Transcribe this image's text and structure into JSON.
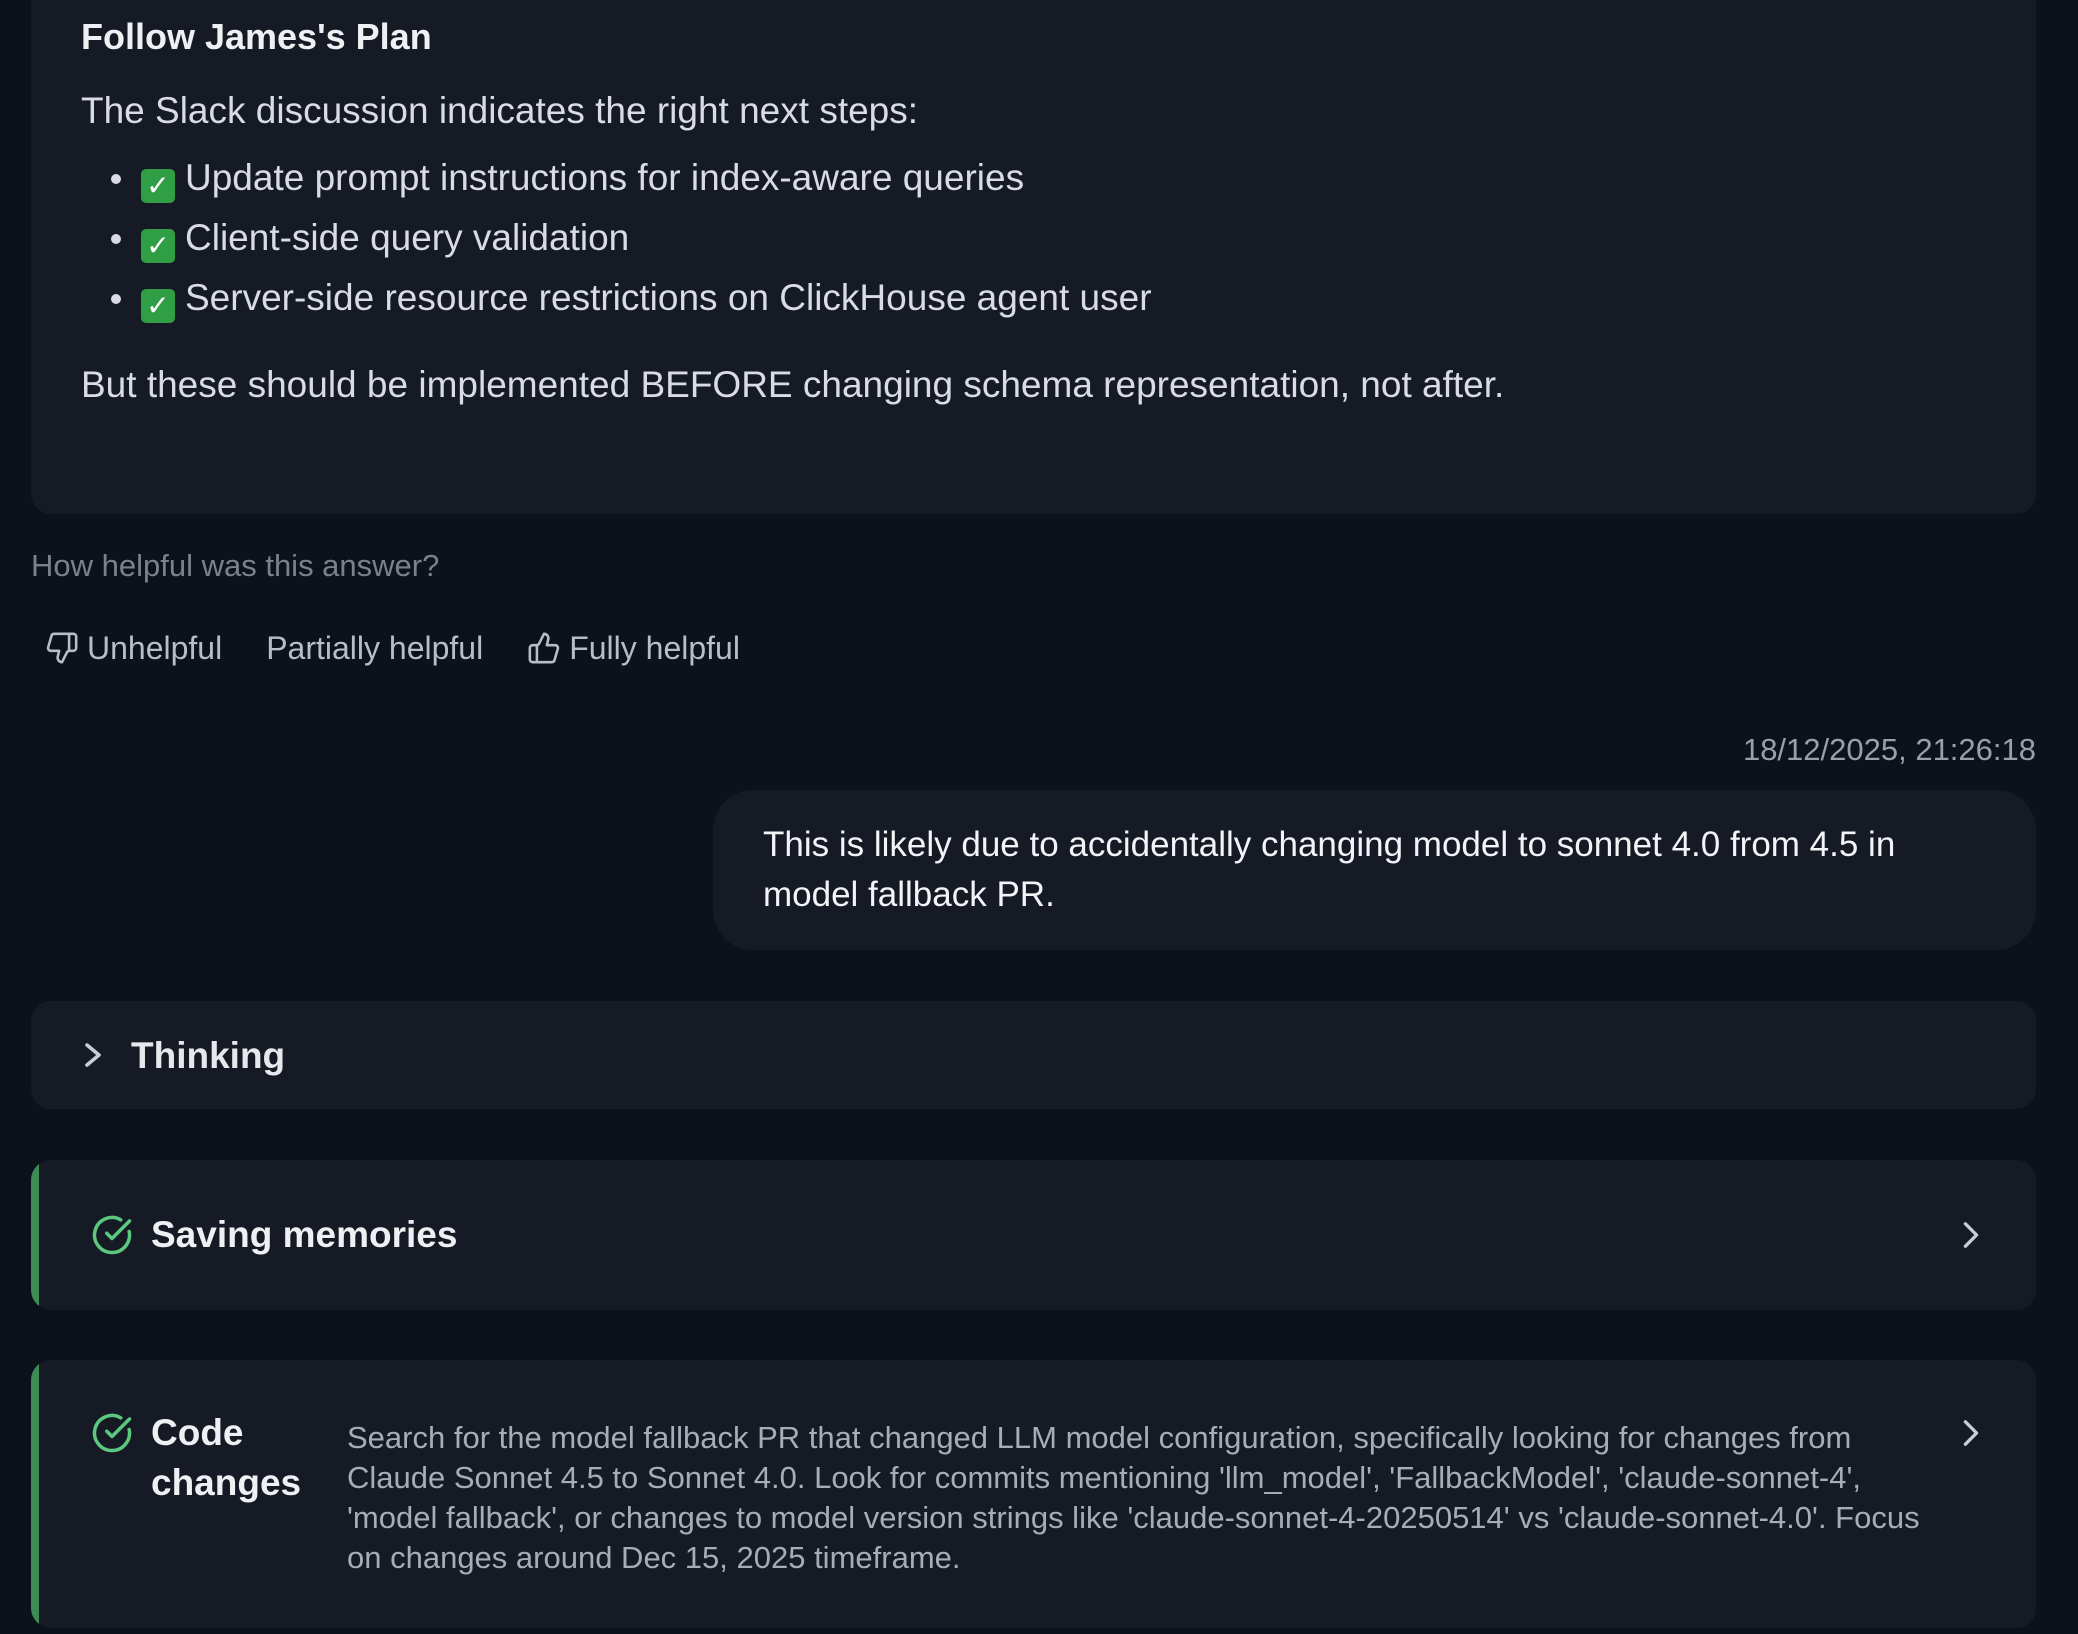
{
  "answer": {
    "title": "Follow James's Plan",
    "intro": "The Slack discussion indicates the right next steps:",
    "items": [
      "Update prompt instructions for index-aware queries",
      "Client-side query validation",
      "Server-side resource restrictions on ClickHouse agent user"
    ],
    "check_glyph": "✓",
    "footer": "But these should be implemented BEFORE changing schema representation, not after."
  },
  "feedback": {
    "question": "How helpful was this answer?",
    "unhelpful_label": "Unhelpful",
    "partial_label": "Partially helpful",
    "fully_label": "Fully helpful"
  },
  "user_message": {
    "timestamp": "18/12/2025, 21:26:18",
    "text": "This is likely due to accidentally changing model to sonnet 4.0 from 4.5 in model fallback PR."
  },
  "thinking": {
    "label": "Thinking"
  },
  "tools": [
    {
      "title": "Saving memories",
      "status": "completed",
      "icon": "check-circle-icon"
    },
    {
      "title": "Code changes",
      "status": "completed",
      "icon": "check-circle-icon",
      "description": "Search for the model fallback PR that changed LLM model configuration, specifically looking for changes from Claude Sonnet 4.5 to Sonnet 4.0. Look for commits mentioning 'llm_model', 'FallbackModel', 'claude-sonnet-4', 'model fallback', or changes to model version strings like 'claude-sonnet-4-20250514' vs 'claude-sonnet-4.0'. Focus on changes around Dec 15, 2025 timeframe."
    }
  ],
  "colors": {
    "background": "#0d111a",
    "card": "#151a24",
    "success_green": "#3d8c56",
    "check_icon_green": "#5cc77e",
    "emoji_check_bg": "#2f9e44"
  }
}
